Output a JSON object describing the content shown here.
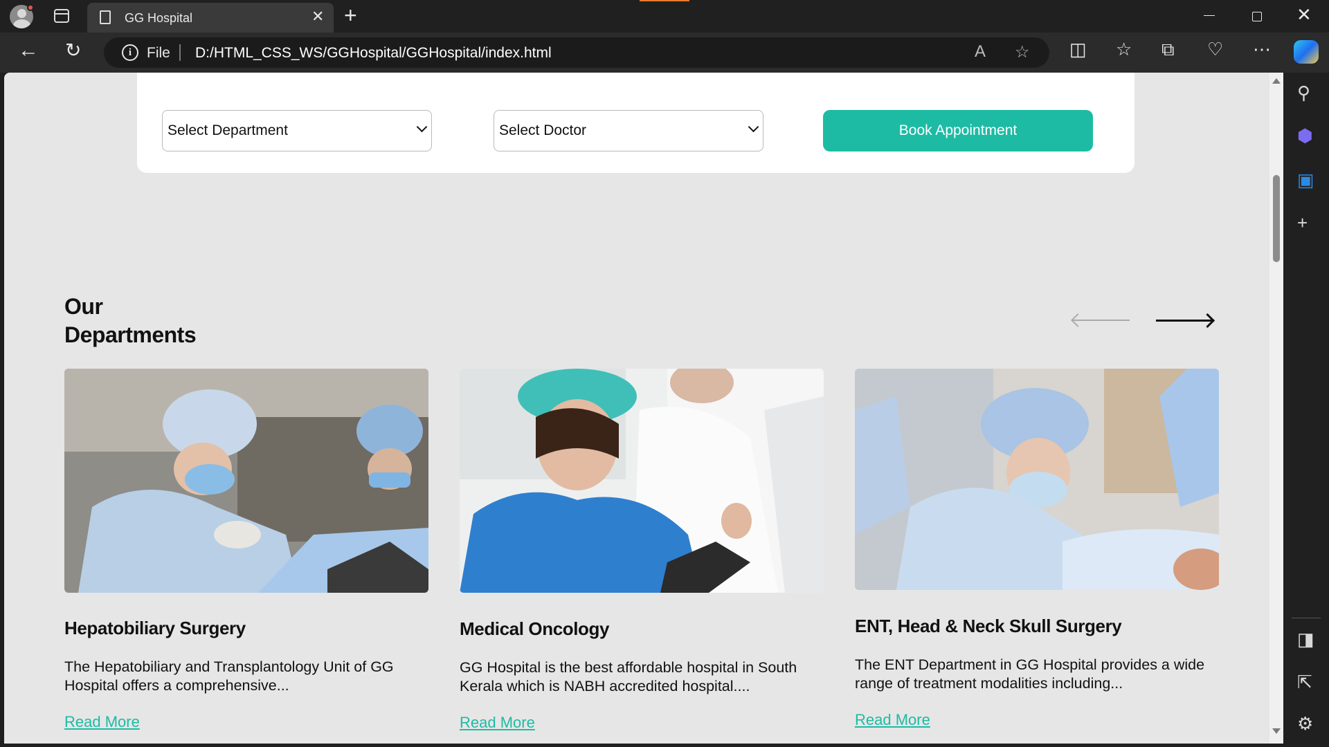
{
  "browser": {
    "tab_title": "GG Hospital",
    "url_scheme": "File",
    "url": "D:/HTML_CSS_WS/GGHospital/GGHospital/index.html"
  },
  "appointment": {
    "department_select": "Select Department",
    "doctor_select": "Select Doctor",
    "book_label": "Book Appointment"
  },
  "departments": {
    "title_line1": "Our",
    "title_line2": "Departments",
    "cards": [
      {
        "title": "Hepatobiliary Surgery",
        "text": "The Hepatobiliary and Transplantology Unit of GG Hospital offers a comprehensive...",
        "link": "Read More"
      },
      {
        "title": "Medical Oncology",
        "text": "GG Hospital is the best affordable hospital in South Kerala which is NABH accredited hospital....",
        "link": "Read More"
      },
      {
        "title": "ENT, Head & Neck Skull Surgery",
        "text": "The ENT Department in GG Hospital provides a wide range of treatment modalities including...",
        "link": "Read More"
      }
    ]
  },
  "colors": {
    "accent": "#1dbba4",
    "page_bg": "#e6e6e6",
    "chrome_bg": "#202020"
  }
}
